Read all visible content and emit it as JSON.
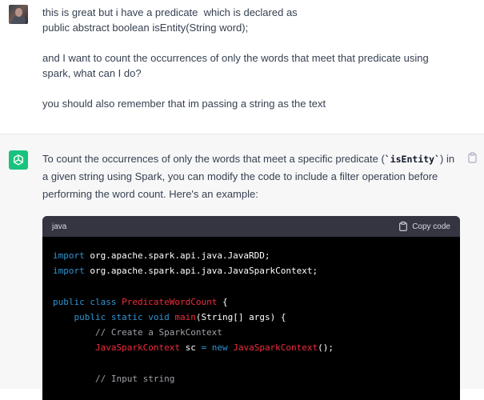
{
  "user_message": {
    "line1": "this is great but i have a predicate  which is declared as",
    "line2": "public abstract boolean isEntity(String word);",
    "line3": "and I want to count the occurrences of only the words that meet that predicate using spark, what can I do?",
    "line4": "you should also remember that im passing a string as the text"
  },
  "assistant_message": {
    "intro_before": "To count the occurrences of only the words that meet a specific predicate (",
    "intro_code": "`isEntity`",
    "intro_after": ") in a given string using Spark, you can modify the code to include a filter operation before performing the word count. Here's an example:",
    "code_block": {
      "language": "java",
      "copy_label": "Copy code",
      "lines": {
        "l1_kw": "import",
        "l1_rest": " org.apache.spark.api.java.JavaRDD;",
        "l2_kw": "import",
        "l2_rest": " org.apache.spark.api.java.JavaSparkContext;",
        "l3_kw1": "public",
        "l3_kw2": "class",
        "l3_cls": "PredicateWordCount",
        "l3_rest": " {",
        "l4_kw1": "public",
        "l4_kw2": "static",
        "l4_kw3": "void",
        "l4_fn": "main",
        "l4_rest": "(String[] args) {",
        "l5_cm": "// Create a SparkContext",
        "l6_cls1": "JavaSparkContext",
        "l6_var": " sc ",
        "l6_eq": "=",
        "l6_kw": "new",
        "l6_cls2": "JavaSparkContext",
        "l6_rest": "();",
        "l7_cm": "// Input string"
      }
    }
  },
  "colors": {
    "gpt_green": "#19c37d",
    "keyword": "#2e95d3",
    "class_name": "#f22c3d",
    "comment": "#a0a1a7"
  }
}
